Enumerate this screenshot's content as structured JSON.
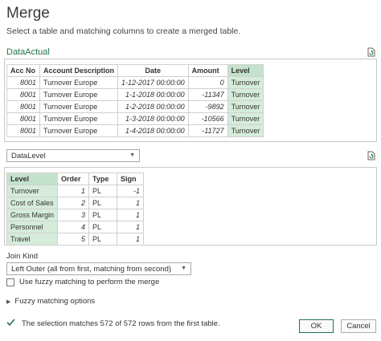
{
  "dialog": {
    "title": "Merge",
    "subtitle": "Select a table and matching columns to create a merged table."
  },
  "table1": {
    "name": "DataActual",
    "headers": [
      "Acc No",
      "Account Description",
      "Date",
      "Amount",
      "Level"
    ],
    "rows": [
      [
        "8001",
        "Turnover Europe",
        "1-12-2017 00:00:00",
        "0",
        "Turnover"
      ],
      [
        "8001",
        "Turnover Europe",
        "1-1-2018 00:00:00",
        "-11347",
        "Turnover"
      ],
      [
        "8001",
        "Turnover Europe",
        "1-2-2018 00:00:00",
        "-9892",
        "Turnover"
      ],
      [
        "8001",
        "Turnover Europe",
        "1-3-2018 00:00:00",
        "-10566",
        "Turnover"
      ],
      [
        "8001",
        "Turnover Europe",
        "1-4-2018 00:00:00",
        "-11727",
        "Turnover"
      ]
    ]
  },
  "table2": {
    "selected": "DataLevel",
    "headers": [
      "Level",
      "Order",
      "Type",
      "Sign"
    ],
    "rows": [
      [
        "Turnover",
        "1",
        "PL",
        "-1"
      ],
      [
        "Cost of Sales",
        "2",
        "PL",
        "1"
      ],
      [
        "Gross Margin",
        "3",
        "PL",
        "1"
      ],
      [
        "Personnel",
        "4",
        "PL",
        "1"
      ],
      [
        "Travel",
        "5",
        "PL",
        "1"
      ]
    ]
  },
  "join": {
    "label": "Join Kind",
    "selected": "Left Outer (all from first, matching from second)"
  },
  "fuzzy_checkbox": {
    "label": "Use fuzzy matching to perform the merge",
    "checked": false
  },
  "fuzzy_options": {
    "label": "Fuzzy matching options"
  },
  "status": {
    "text": "The selection matches 572 of 572 rows from the first table."
  },
  "buttons": {
    "ok": "OK",
    "cancel": "Cancel"
  },
  "colors": {
    "accent": "#217346",
    "selected_column": "#d6ecdb",
    "status_check": "#217346"
  }
}
